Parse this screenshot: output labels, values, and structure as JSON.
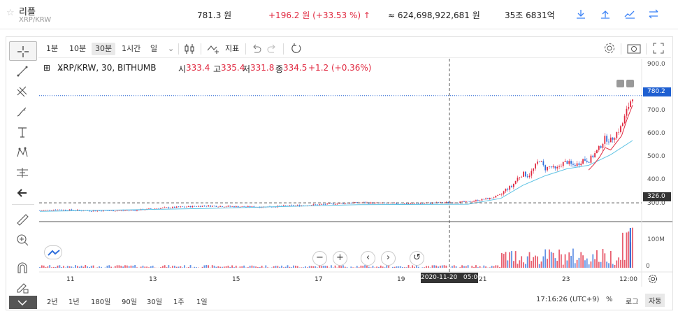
{
  "header": {
    "coin_name": "리플",
    "pair": "XRP/KRW",
    "price": "781.3 원",
    "change": "+196.2 원 (+33.53 %)",
    "change_arrow": "↑",
    "trade_amount": "≈ 624,698,922,681 원",
    "market_cap": "35조 6831억"
  },
  "toolbar": {
    "intervals": [
      "1분",
      "10분",
      "30분",
      "1시간",
      "일"
    ],
    "selected_interval": "30분",
    "indicator_label": "지표"
  },
  "legend": {
    "title": "XRP/KRW, 30, BITHUMB",
    "open_label": "시",
    "open": "333.4",
    "high_label": "고",
    "high": "335.4",
    "low_label": "저",
    "low": "331.8",
    "close_label": "종",
    "close": "334.5",
    "change": "+1.2 (+0.36%)"
  },
  "price_axis": {
    "ticks": [
      "900.0",
      "800.0",
      "700.0",
      "600.0",
      "500.0",
      "400.0",
      "300.0"
    ],
    "last_price_label": "780.2",
    "crosshair_price_label": "326.0"
  },
  "volume_axis": {
    "ticks": [
      "100M",
      "0"
    ]
  },
  "time_axis": {
    "ticks": [
      "11",
      "13",
      "15",
      "17",
      "19",
      "21",
      "23",
      "12:00"
    ],
    "crosshair_label": "2020-11-20   05:00"
  },
  "bottom_bar": {
    "ranges": [
      "2년",
      "1년",
      "180일",
      "90일",
      "30일",
      "1주",
      "1일"
    ],
    "clock": "17:16:26 (UTC+9)",
    "percent": "%",
    "log": "로그",
    "auto": "자동"
  },
  "chart_data": {
    "type": "candlestick",
    "title": "XRP/KRW, 30, BITHUMB",
    "ylim": [
      270,
      910
    ],
    "x_ticks": [
      "11",
      "13",
      "15",
      "17",
      "19",
      "21",
      "23",
      "12:00"
    ],
    "close_series": [
      {
        "t": 0,
        "v": 293
      },
      {
        "t": 3,
        "v": 297
      },
      {
        "t": 10,
        "v": 292
      },
      {
        "t": 17,
        "v": 294
      },
      {
        "t": 23,
        "v": 305
      },
      {
        "t": 30,
        "v": 313
      },
      {
        "t": 40,
        "v": 308
      },
      {
        "t": 49,
        "v": 316
      },
      {
        "t": 58,
        "v": 327
      },
      {
        "t": 66,
        "v": 322
      },
      {
        "t": 71,
        "v": 325
      },
      {
        "t": 78,
        "v": 330
      },
      {
        "t": 82,
        "v": 345
      },
      {
        "t": 84,
        "v": 360
      },
      {
        "t": 85,
        "v": 385
      },
      {
        "t": 86,
        "v": 395
      },
      {
        "t": 87,
        "v": 430
      },
      {
        "t": 88,
        "v": 450
      },
      {
        "t": 89,
        "v": 440
      },
      {
        "t": 90,
        "v": 470
      },
      {
        "t": 91,
        "v": 510
      },
      {
        "t": 92,
        "v": 470
      },
      {
        "t": 93,
        "v": 480
      },
      {
        "t": 94,
        "v": 465
      },
      {
        "t": 95,
        "v": 490
      },
      {
        "t": 96,
        "v": 500
      },
      {
        "t": 97,
        "v": 485
      },
      {
        "t": 98,
        "v": 490
      },
      {
        "t": 99,
        "v": 510
      },
      {
        "t": 100,
        "v": 505
      },
      {
        "t": 101,
        "v": 530
      },
      {
        "t": 102,
        "v": 560
      },
      {
        "t": 103,
        "v": 600
      },
      {
        "t": 104,
        "v": 590
      },
      {
        "t": 105,
        "v": 620
      },
      {
        "t": 106,
        "v": 650
      },
      {
        "t": 107,
        "v": 720
      },
      {
        "t": 108,
        "v": 780
      }
    ],
    "moving_average": [
      {
        "t": 0,
        "v": 290
      },
      {
        "t": 30,
        "v": 302
      },
      {
        "t": 58,
        "v": 318
      },
      {
        "t": 78,
        "v": 320
      },
      {
        "t": 84,
        "v": 345
      },
      {
        "t": 88,
        "v": 400
      },
      {
        "t": 92,
        "v": 440
      },
      {
        "t": 96,
        "v": 470
      },
      {
        "t": 100,
        "v": 485
      },
      {
        "t": 104,
        "v": 530
      },
      {
        "t": 108,
        "v": 590
      }
    ],
    "last_price": 780.2,
    "crosshair_price": 326.0,
    "crosshair_time": "2020-11-20 05:00"
  },
  "colors": {
    "up": "#e0283f",
    "down": "#2f6fdc",
    "ma": "#5fc3e4",
    "accent": "#3b82f6",
    "last_price_bg": "#1e5fd1"
  }
}
